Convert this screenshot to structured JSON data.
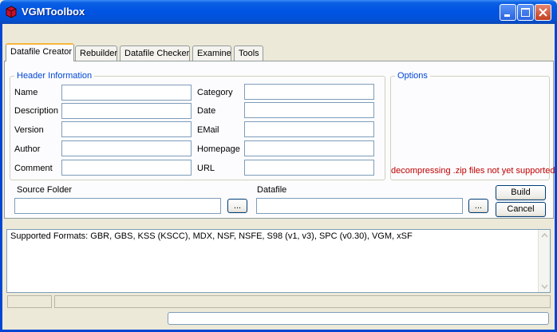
{
  "window": {
    "title": "VGMToolbox"
  },
  "tabs": [
    {
      "label": "Datafile Creator"
    },
    {
      "label": "Rebuilder"
    },
    {
      "label": "Datafile Checker"
    },
    {
      "label": "Examine"
    },
    {
      "label": "Tools"
    }
  ],
  "header_info": {
    "legend": "Header Information",
    "fields": {
      "name": {
        "label": "Name",
        "value": ""
      },
      "description": {
        "label": "Description",
        "value": ""
      },
      "version": {
        "label": "Version",
        "value": ""
      },
      "author": {
        "label": "Author",
        "value": ""
      },
      "comment": {
        "label": "Comment",
        "value": ""
      },
      "category": {
        "label": "Category",
        "value": ""
      },
      "date": {
        "label": "Date",
        "value": ""
      },
      "email": {
        "label": "EMail",
        "value": ""
      },
      "homepage": {
        "label": "Homepage",
        "value": ""
      },
      "url": {
        "label": "URL",
        "value": ""
      }
    }
  },
  "options": {
    "legend": "Options",
    "warning": "decompressing .zip files not yet supported"
  },
  "source_folder": {
    "label": "Source Folder",
    "value": "",
    "browse": "..."
  },
  "datafile": {
    "label": "Datafile",
    "value": "",
    "browse": "..."
  },
  "buttons": {
    "build": "Build",
    "cancel": "Cancel"
  },
  "output": {
    "text": "Supported Formats: GBR, GBS, KSS (KSCC), MDX, NSF, NSFE, S98 (v1, v3), SPC (v0.30), VGM, xSF"
  },
  "colors": {
    "titlebar": "#0054e3",
    "legend": "#0046d5",
    "warning": "#c00000",
    "active_tab_accent": "#f7b63d"
  }
}
